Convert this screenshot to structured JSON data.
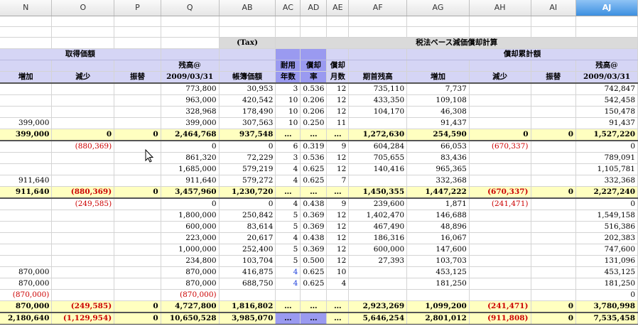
{
  "columns": [
    "N",
    "O",
    "P",
    "Q",
    "AB",
    "AC",
    "AD",
    "AE",
    "AF",
    "AG",
    "AH",
    "AI",
    "AJ"
  ],
  "selected_column": "AJ",
  "headers": {
    "tax_tag": "(Tax)",
    "tax_title": "税法ベース減価償却計算",
    "acq_title": "取得価額",
    "dep_title": "償却累計額",
    "zandaka": "残高@",
    "date": "2009/03/31",
    "increase": "増加",
    "decrease": "減少",
    "transfer": "振替",
    "book_value": "帳簿価額",
    "life_top": "耐用",
    "life_bottom": "年数",
    "rate_top": "償却",
    "rate_bottom": "率",
    "months_top": "償却",
    "months_bottom": "月数",
    "opening": "期首残高"
  },
  "rows": [
    {
      "type": "data",
      "N": "",
      "O": "",
      "P": "",
      "Q": "773,800",
      "AB": "30,953",
      "AC": "3",
      "AD": "0.536",
      "AE": "12",
      "AF": "735,110",
      "AG": "7,737",
      "AH": "",
      "AI": "",
      "AJ": "742,847"
    },
    {
      "type": "data",
      "N": "",
      "O": "",
      "P": "",
      "Q": "963,000",
      "AB": "420,542",
      "AC": "10",
      "AD": "0.206",
      "AE": "12",
      "AF": "433,350",
      "AG": "109,108",
      "AH": "",
      "AI": "",
      "AJ": "542,458"
    },
    {
      "type": "data",
      "N": "",
      "O": "",
      "P": "",
      "Q": "328,968",
      "AB": "178,490",
      "AC": "10",
      "AD": "0.206",
      "AE": "12",
      "AF": "104,170",
      "AG": "46,308",
      "AH": "",
      "AI": "",
      "AJ": "150,478"
    },
    {
      "type": "data",
      "N": "399,000",
      "O": "",
      "P": "",
      "Q": "399,000",
      "AB": "307,563",
      "AC": "10",
      "AD": "0.250",
      "AE": "11",
      "AF": "",
      "AG": "91,437",
      "AH": "",
      "AI": "",
      "AJ": "91,437"
    },
    {
      "type": "sub",
      "N": "399,000",
      "O": "0",
      "P": "0",
      "Q": "2,464,768",
      "AB": "937,548",
      "AC": "…",
      "AD": "…",
      "AE": "…",
      "AF": "1,272,630",
      "AG": "254,590",
      "AH": "0",
      "AI": "0",
      "AJ": "1,527,220"
    },
    {
      "type": "data",
      "N": "",
      "O": "(880,369)",
      "P": "",
      "Q": "0",
      "AB": "0",
      "AC": "6",
      "AD": "0.319",
      "AE": "9",
      "AF": "604,284",
      "AG": "66,053",
      "AH": "(670,337)",
      "AI": "",
      "AJ": "0"
    },
    {
      "type": "data",
      "N": "",
      "O": "",
      "P": "",
      "Q": "861,320",
      "AB": "72,229",
      "AC": "3",
      "AD": "0.536",
      "AE": "12",
      "AF": "705,655",
      "AG": "83,436",
      "AH": "",
      "AI": "",
      "AJ": "789,091"
    },
    {
      "type": "data",
      "N": "",
      "O": "",
      "P": "",
      "Q": "1,685,000",
      "AB": "579,219",
      "AC": "4",
      "AD": "0.625",
      "AE": "12",
      "AF": "140,416",
      "AG": "965,365",
      "AH": "",
      "AI": "",
      "AJ": "1,105,781"
    },
    {
      "type": "data",
      "N": "911,640",
      "O": "",
      "P": "",
      "Q": "911,640",
      "AB": "579,272",
      "AC": "4",
      "AD": "0.625",
      "AE": "7",
      "AF": "",
      "AG": "332,368",
      "AH": "",
      "AI": "",
      "AJ": "332,368"
    },
    {
      "type": "sub",
      "N": "911,640",
      "O": "(880,369)",
      "P": "0",
      "Q": "3,457,960",
      "AB": "1,230,720",
      "AC": "…",
      "AD": "…",
      "AE": "…",
      "AF": "1,450,355",
      "AG": "1,447,222",
      "AH": "(670,337)",
      "AI": "0",
      "AJ": "2,227,240"
    },
    {
      "type": "data",
      "N": "",
      "O": "(249,585)",
      "P": "",
      "Q": "0",
      "AB": "0",
      "AC": "4",
      "AD": "0.438",
      "AE": "9",
      "AF": "239,600",
      "AG": "1,871",
      "AH": "(241,471)",
      "AI": "",
      "AJ": "0"
    },
    {
      "type": "data",
      "N": "",
      "O": "",
      "P": "",
      "Q": "1,800,000",
      "AB": "250,842",
      "AC": "5",
      "AD": "0.369",
      "AE": "12",
      "AF": "1,402,470",
      "AG": "146,688",
      "AH": "",
      "AI": "",
      "AJ": "1,549,158"
    },
    {
      "type": "data",
      "N": "",
      "O": "",
      "P": "",
      "Q": "600,000",
      "AB": "83,614",
      "AC": "5",
      "AD": "0.369",
      "AE": "12",
      "AF": "467,490",
      "AG": "48,896",
      "AH": "",
      "AI": "",
      "AJ": "516,386"
    },
    {
      "type": "data",
      "N": "",
      "O": "",
      "P": "",
      "Q": "223,000",
      "AB": "20,617",
      "AC": "4",
      "AD": "0.438",
      "AE": "12",
      "AF": "186,316",
      "AG": "16,067",
      "AH": "",
      "AI": "",
      "AJ": "202,383"
    },
    {
      "type": "data",
      "N": "",
      "O": "",
      "P": "",
      "Q": "1,000,000",
      "AB": "252,400",
      "AC": "5",
      "AD": "0.369",
      "AE": "12",
      "AF": "600,000",
      "AG": "147,600",
      "AH": "",
      "AI": "",
      "AJ": "747,600"
    },
    {
      "type": "data",
      "N": "",
      "O": "",
      "P": "",
      "Q": "234,800",
      "AB": "103,704",
      "AC": "5",
      "AD": "0.500",
      "AE": "12",
      "AF": "27,393",
      "AG": "103,703",
      "AH": "",
      "AI": "",
      "AJ": "131,096"
    },
    {
      "type": "data",
      "N": "870,000",
      "O": "",
      "P": "",
      "Q": "870,000",
      "AB": "416,875",
      "AC": "4",
      "AD": "0.625",
      "AE": "10",
      "AF": "",
      "AG": "453,125",
      "AH": "",
      "AI": "",
      "AJ": "453,125",
      "blueAC": true
    },
    {
      "type": "data",
      "N": "870,000",
      "O": "",
      "P": "",
      "Q": "870,000",
      "AB": "688,750",
      "AC": "4",
      "AD": "0.625",
      "AE": "4",
      "AF": "",
      "AG": "181,250",
      "AH": "",
      "AI": "",
      "AJ": "181,250",
      "blueAC": true
    },
    {
      "type": "data",
      "N": "(870,000)",
      "O": "",
      "P": "",
      "Q": "(870,000)",
      "AB": "",
      "AC": "",
      "AD": "",
      "AE": "",
      "AF": "",
      "AG": "",
      "AH": "",
      "AI": "",
      "AJ": "0"
    },
    {
      "type": "sub",
      "N": "870,000",
      "O": "(249,585)",
      "P": "0",
      "Q": "4,727,800",
      "AB": "1,816,802",
      "AC": "…",
      "AD": "…",
      "AE": "…",
      "AF": "2,923,269",
      "AG": "1,099,200",
      "AH": "(241,471)",
      "AI": "0",
      "AJ": "3,780,998"
    },
    {
      "type": "grand",
      "N": "2,180,640",
      "O": "(1,129,954)",
      "P": "0",
      "Q": "10,650,528",
      "AB": "3,985,070",
      "AC": "…",
      "AD": "…",
      "AE": "…",
      "AF": "5,646,254",
      "AG": "2,801,012",
      "AH": "(911,808)",
      "AI": "0",
      "AJ": "7,535,458"
    }
  ]
}
